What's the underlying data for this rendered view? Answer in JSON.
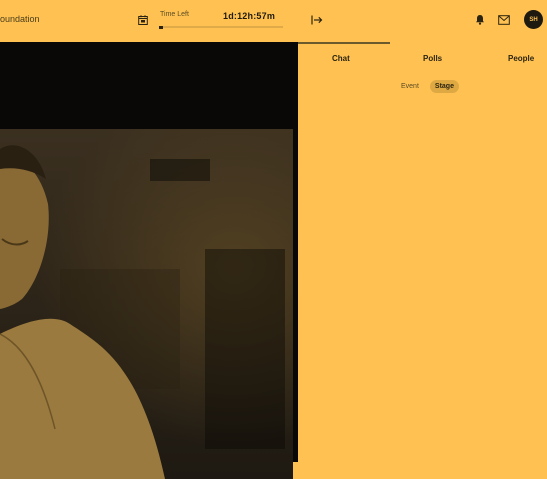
{
  "header": {
    "org_name": "oundation",
    "time_left_label": "Time Left",
    "time_left_value": "1d:12h:57m",
    "time_progress": 0.03
  },
  "icons": {
    "timer": "calendar-timer-icon",
    "collapse": "collapse-panel-icon",
    "notifications": "bell-icon",
    "messages": "mail-icon"
  },
  "user": {
    "avatar_initials": "SH"
  },
  "panel": {
    "tabs": [
      {
        "label": "Chat"
      },
      {
        "label": "Polls"
      },
      {
        "label": "People"
      }
    ],
    "subtabs": [
      {
        "label": "Event"
      },
      {
        "label": "Stage",
        "active": true
      }
    ]
  },
  "colors": {
    "accent": "#FFC252",
    "dark": "#1e1a10",
    "stage_bg": "#0a0806"
  }
}
